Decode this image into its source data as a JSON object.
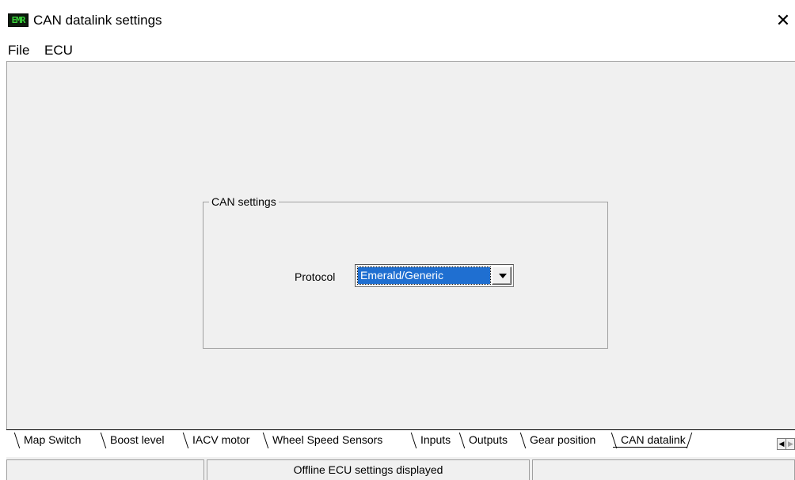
{
  "window": {
    "icon_text": "EMR",
    "title": "CAN datalink settings",
    "close_glyph": "✕"
  },
  "menu": {
    "items": [
      "File",
      "ECU"
    ]
  },
  "can_settings": {
    "group_title": "CAN settings",
    "protocol_label": "Protocol",
    "protocol_value": "Emerald/Generic"
  },
  "tabs": {
    "items": [
      "Map Switch",
      "Boost level",
      "IACV motor",
      "Wheel Speed Sensors",
      "Inputs",
      "Outputs",
      "Gear position",
      "CAN datalink"
    ],
    "active": "CAN datalink"
  },
  "status": {
    "left": "",
    "center": "Offline ECU settings displayed",
    "right": ""
  },
  "colors": {
    "selection": "#1f6fd1",
    "panel": "#f0f0f0"
  }
}
